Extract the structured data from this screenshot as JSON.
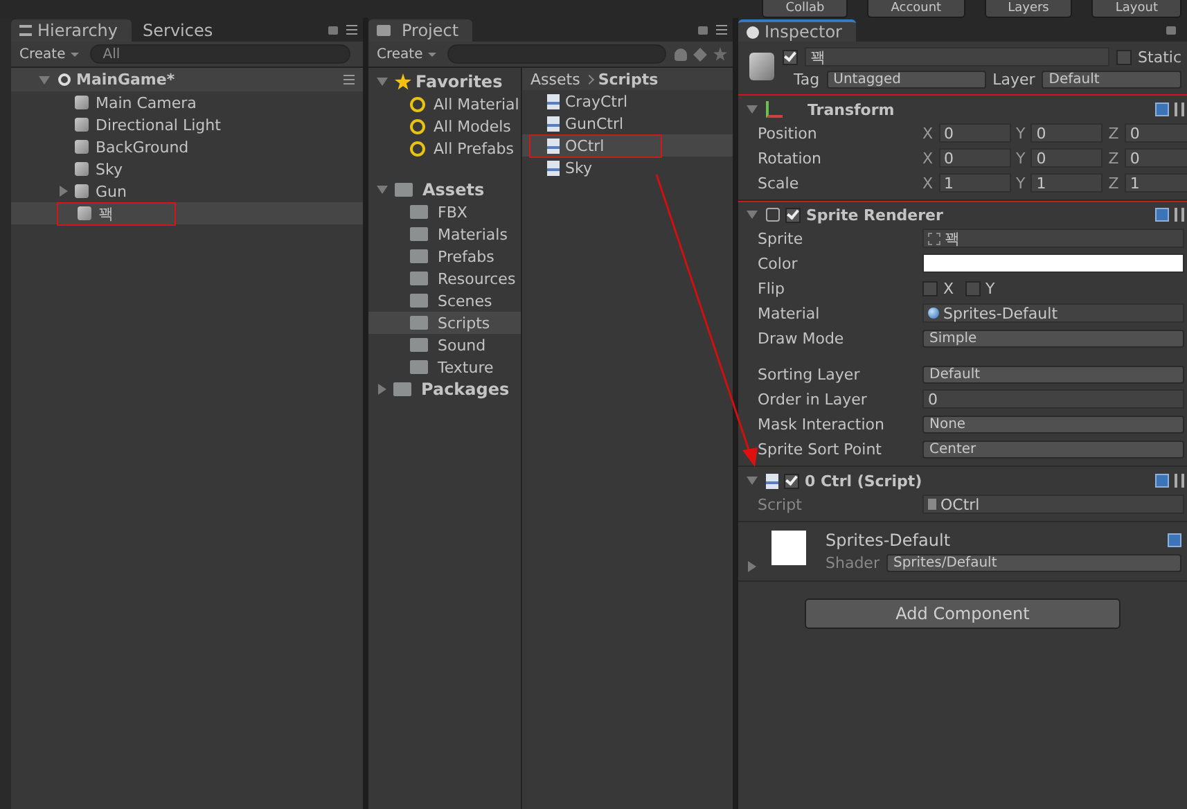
{
  "toolbar": [
    "Collab",
    "Account",
    "Layers",
    "Layout"
  ],
  "hierarchy": {
    "tabs": [
      {
        "label": "Hierarchy",
        "selected": true
      },
      {
        "label": "Services",
        "selected": false
      }
    ],
    "create": "Create",
    "search_placeholder": "All",
    "scene": {
      "name": "MainGame*",
      "expanded": true
    },
    "items": [
      {
        "label": "Main Camera",
        "has_children": false,
        "selected": false,
        "highlighted": false
      },
      {
        "label": "Directional Light",
        "has_children": false,
        "selected": false,
        "highlighted": false
      },
      {
        "label": "BackGround",
        "has_children": false,
        "selected": false,
        "highlighted": false
      },
      {
        "label": "Sky",
        "has_children": false,
        "selected": false,
        "highlighted": false
      },
      {
        "label": "Gun",
        "has_children": true,
        "selected": false,
        "highlighted": false
      },
      {
        "label": "꽥",
        "has_children": false,
        "selected": true,
        "highlighted": true
      }
    ]
  },
  "project": {
    "tab": "Project",
    "create": "Create",
    "favorites": {
      "label": "Favorites",
      "expanded": true,
      "items": [
        "All Material",
        "All Models",
        "All Prefabs"
      ]
    },
    "assets": {
      "label": "Assets",
      "expanded": true,
      "items": [
        {
          "label": "FBX",
          "selected": false
        },
        {
          "label": "Materials",
          "selected": false
        },
        {
          "label": "Prefabs",
          "selected": false
        },
        {
          "label": "Resources",
          "selected": false
        },
        {
          "label": "Scenes",
          "selected": false
        },
        {
          "label": "Scripts",
          "selected": true
        },
        {
          "label": "Sound",
          "selected": false
        },
        {
          "label": "Texture",
          "selected": false
        }
      ]
    },
    "packages": {
      "label": "Packages",
      "expanded": false
    },
    "breadcrumb": [
      "Assets",
      "Scripts"
    ],
    "files": [
      {
        "label": "CrayCtrl",
        "selected": false,
        "highlighted": false
      },
      {
        "label": "GunCtrl",
        "selected": false,
        "highlighted": false
      },
      {
        "label": "OCtrl",
        "selected": true,
        "highlighted": true
      },
      {
        "label": "Sky",
        "selected": false,
        "highlighted": false
      }
    ]
  },
  "inspector": {
    "tab": "Inspector",
    "object": {
      "active": true,
      "name": "꽥",
      "static_label": "Static",
      "static": false,
      "tag_label": "Tag",
      "tag": "Untagged",
      "layer_label": "Layer",
      "layer": "Default"
    },
    "transform": {
      "title": "Transform",
      "expanded": true,
      "highlighted": true,
      "rows": [
        {
          "label": "Position",
          "values": [
            {
              "axis": "X",
              "value": "0"
            },
            {
              "axis": "Y",
              "value": "0"
            },
            {
              "axis": "Z",
              "value": "0"
            }
          ]
        },
        {
          "label": "Rotation",
          "values": [
            {
              "axis": "X",
              "value": "0"
            },
            {
              "axis": "Y",
              "value": "0"
            },
            {
              "axis": "Z",
              "value": "0"
            }
          ]
        },
        {
          "label": "Scale",
          "values": [
            {
              "axis": "X",
              "value": "1"
            },
            {
              "axis": "Y",
              "value": "1"
            },
            {
              "axis": "Z",
              "value": "1"
            }
          ]
        }
      ]
    },
    "sprite_renderer": {
      "title": "Sprite Renderer",
      "expanded": true,
      "enabled": true,
      "field_groups": [
        [
          {
            "label": "Sprite",
            "kind": "object",
            "value": "꽥"
          },
          {
            "label": "Color",
            "kind": "color",
            "color": "#ffffff"
          },
          {
            "label": "Flip",
            "kind": "flip",
            "options": [
              {
                "label": "X",
                "checked": false
              },
              {
                "label": "Y",
                "checked": false
              }
            ]
          },
          {
            "label": "Material",
            "kind": "material",
            "value": "Sprites-Default"
          },
          {
            "label": "Draw Mode",
            "kind": "dropdown",
            "value": "Simple"
          }
        ],
        [
          {
            "label": "Sorting Layer",
            "kind": "dropdown",
            "value": "Default"
          },
          {
            "label": "Order in Layer",
            "kind": "number",
            "value": "0"
          },
          {
            "label": "Mask Interaction",
            "kind": "dropdown",
            "value": "None"
          },
          {
            "label": "Sprite Sort Point",
            "kind": "dropdown",
            "value": "Center"
          }
        ]
      ]
    },
    "script": {
      "title": "0 Ctrl (Script)",
      "expanded": true,
      "enabled": true,
      "field_label": "Script",
      "value": "OCtrl"
    },
    "material": {
      "name": "Sprites-Default",
      "expanded": false,
      "shader_label": "Shader",
      "shader": "Sprites/Default"
    },
    "add_component": "Add Component"
  }
}
